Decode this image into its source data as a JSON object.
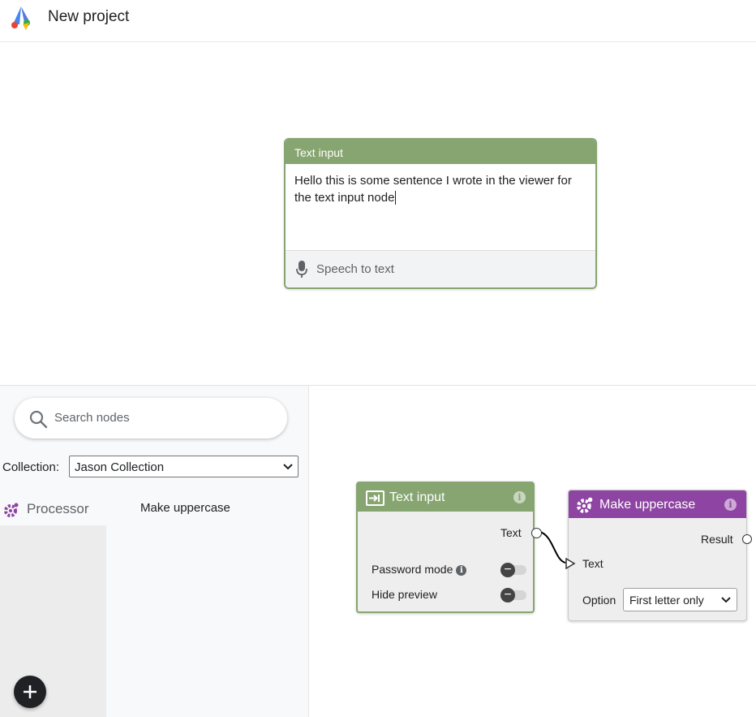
{
  "header": {
    "title": "New project",
    "logo": "app-logo"
  },
  "viewer": {
    "card_title": "Text input",
    "text": "Hello this is some sentence I wrote in the viewer for the text input node",
    "speech_label": "Speech to text",
    "accent": "#87a570"
  },
  "sidebar": {
    "search_placeholder": "Search nodes",
    "collection_label": "Collection:",
    "collection_value": "Jason Collection",
    "category": "Processor",
    "node_item": "Make uppercase"
  },
  "graph": {
    "text_node": {
      "title": "Text input",
      "output_label": "Text",
      "password_label": "Password mode",
      "hide_label": "Hide preview",
      "color": "#87a570"
    },
    "upper_node": {
      "title": "Make uppercase",
      "output_label": "Result",
      "input_label": "Text",
      "option_label": "Option",
      "option_value": "First letter only",
      "color": "#8e44a2"
    }
  },
  "info_glyph": "i"
}
